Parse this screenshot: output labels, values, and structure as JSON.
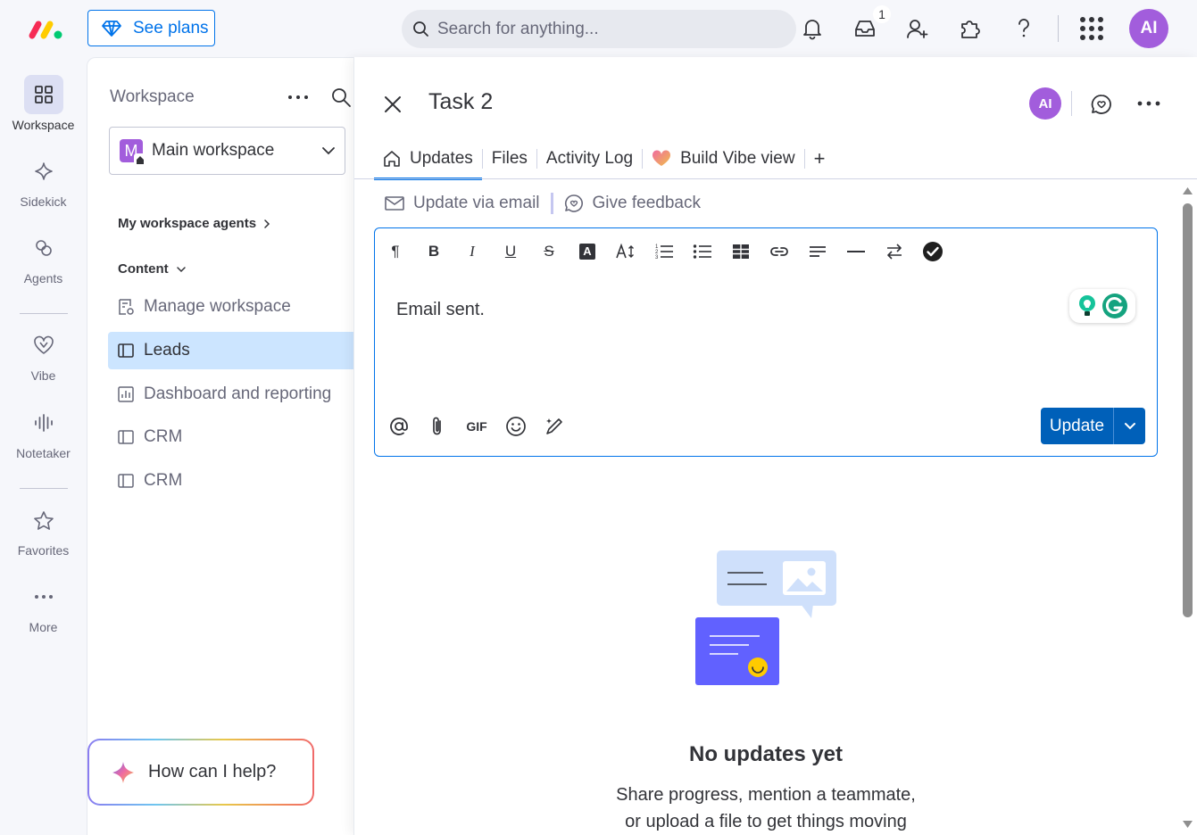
{
  "topbar": {
    "see_plans_label": "See plans",
    "search_placeholder": "Search for anything...",
    "inbox_badge": "1",
    "avatar_initials": "AI"
  },
  "rail": {
    "items": [
      {
        "label": "Workspace",
        "icon": "grid-icon",
        "active": true
      },
      {
        "label": "Sidekick",
        "icon": "sparkle-icon"
      },
      {
        "label": "Agents",
        "icon": "agents-icon"
      },
      {
        "label": "Vibe",
        "icon": "vibe-heart-icon"
      },
      {
        "label": "Notetaker",
        "icon": "waveform-icon"
      },
      {
        "label": "Favorites",
        "icon": "star-icon"
      },
      {
        "label": "More",
        "icon": "more-dots-icon"
      }
    ]
  },
  "sidebar": {
    "title": "Workspace",
    "workspace_letter": "M",
    "workspace_name": "Main workspace",
    "agents_link": "My workspace agents",
    "content_header": "Content",
    "items": [
      {
        "label": "Manage workspace",
        "icon": "manage-icon"
      },
      {
        "label": "Leads",
        "icon": "board-icon",
        "active": true
      },
      {
        "label": "Dashboard and reporting",
        "icon": "dashboard-icon"
      },
      {
        "label": "CRM",
        "icon": "board-icon"
      },
      {
        "label": "CRM",
        "icon": "board-icon"
      }
    ],
    "help_prompt": "How can I help?"
  },
  "panel": {
    "title": "Task 2",
    "avatar_initials": "AI",
    "tabs": [
      {
        "label": "Updates",
        "active": true
      },
      {
        "label": "Files"
      },
      {
        "label": "Activity Log"
      },
      {
        "label": "Build Vibe view"
      },
      {
        "label": "+"
      }
    ],
    "sublinks": {
      "update_via_email": "Update via email",
      "give_feedback": "Give feedback"
    },
    "editor": {
      "text": "Email sent.",
      "gif_label": "GIF",
      "update_button": "Update"
    },
    "empty_state": {
      "title": "No updates yet",
      "line1": "Share progress, mention a teammate,",
      "line2": "or upload a file to get things moving"
    }
  },
  "colors": {
    "accent": "#0073ea",
    "avatar": "#a25ddc",
    "active_nav": "#cce5ff",
    "update_button": "#0060b9"
  }
}
